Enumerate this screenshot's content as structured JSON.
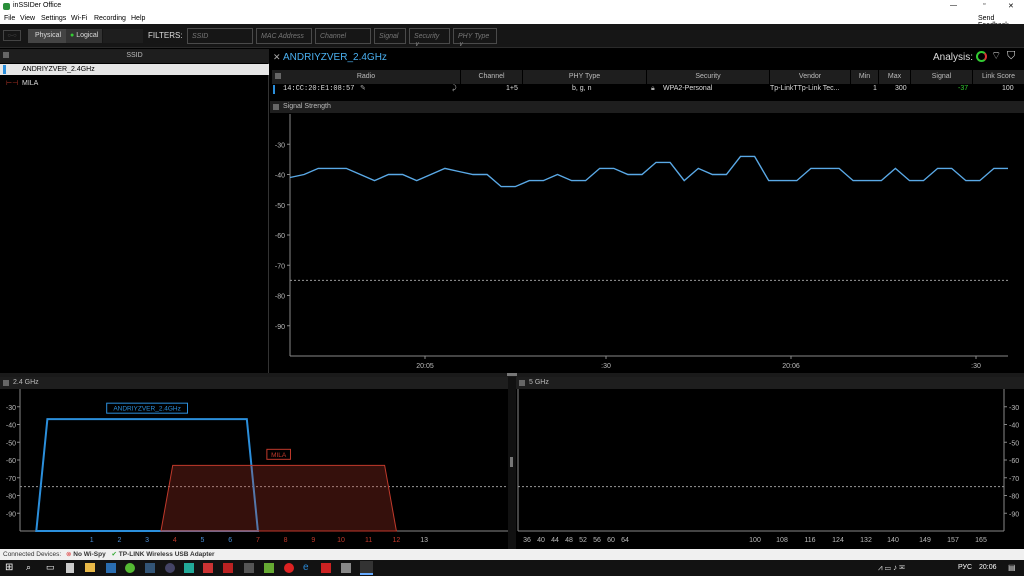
{
  "titlebar": {
    "title": "inSSIDer Office",
    "min": "—",
    "max": "▫",
    "close": "✕"
  },
  "menu": {
    "items": [
      "File",
      "View",
      "Settings",
      "Wi-Fi",
      "Recording",
      "Help"
    ],
    "feedback": "Send Feedback"
  },
  "toolbar": {
    "physical": "Physical",
    "logical": "Logical",
    "filters_label": "FILTERS:",
    "filters": [
      "SSID",
      "MAC Address",
      "Channel",
      "Signal",
      "Security ∨",
      "PHY Type ∨"
    ]
  },
  "ssid_panel": {
    "header": "SSID",
    "networks": [
      {
        "name": "ANDRIYZVER_2.4GHz",
        "color": "#2b8fdc"
      },
      {
        "name": "MILA",
        "color": "#c0392b"
      }
    ]
  },
  "detail": {
    "network": "ANDRIYZVER_2.4GHz",
    "analysis_label": "Analysis:",
    "columns": [
      "Radio",
      "Channel",
      "PHY Type",
      "Security",
      "Vendor",
      "Min",
      "Max",
      "Signal",
      "Link Score"
    ],
    "row": {
      "radio": "14:CC:20:E1:08:57",
      "channel": "1+5",
      "phy": "b, g, n",
      "security": "WPA2-Personal",
      "vendor": "Tp-LinkTTp-Link Tec...",
      "min": "1",
      "max": "300",
      "signal": "-37",
      "link_score": "100"
    }
  },
  "signal_panel": {
    "title": "Signal Strength"
  },
  "band24": {
    "title": "2.4 GHz"
  },
  "band5": {
    "title": "5 GHz"
  },
  "status": {
    "label": "Connected Devices:",
    "item1": "No Wi-Spy",
    "item2": "TP-LINK Wireless USB Adapter"
  },
  "taskbar": {
    "lang": "РУС",
    "time": "20:06"
  },
  "chart_data": [
    {
      "type": "line",
      "title": "Signal Strength",
      "ylim": [
        -100,
        -20
      ],
      "y_ticks": [
        "-30",
        "-40",
        "-50",
        "-60",
        "-70",
        "-80",
        "-90"
      ],
      "x_ticks": [
        "20:05",
        ":30",
        "20:06",
        ":30"
      ],
      "threshold": -75,
      "series": [
        {
          "name": "ANDRIYZVER_2.4GHz",
          "color": "#5aa9e6",
          "values": [
            -41,
            -40,
            -38,
            -38,
            -38,
            -40,
            -42,
            -40,
            -40,
            -42,
            -40,
            -38,
            -39,
            -40,
            -40,
            -44,
            -44,
            -42,
            -42,
            -40,
            -42,
            -42,
            -38,
            -38,
            -40,
            -40,
            -36,
            -36,
            -42,
            -38,
            -40,
            -40,
            -34,
            -34,
            -42,
            -42,
            -42,
            -38,
            -38,
            -38,
            -42,
            -42,
            -42,
            -38,
            -42,
            -42,
            -38,
            -38,
            -42,
            -42,
            -38,
            -38
          ]
        }
      ]
    },
    {
      "type": "area",
      "title": "2.4 GHz",
      "ylim": [
        -100,
        -20
      ],
      "y_ticks": [
        "-30",
        "-40",
        "-50",
        "-60",
        "-70",
        "-80",
        "-90"
      ],
      "x_ticks": [
        "1",
        "2",
        "3",
        "4",
        "5",
        "6",
        "7",
        "8",
        "9",
        "10",
        "11",
        "12",
        "13"
      ],
      "threshold": -75,
      "series": [
        {
          "name": "ANDRIYZVER_2.4GHz",
          "color": "#2b8fdc",
          "from": -1,
          "to": 7,
          "level": -37
        },
        {
          "name": "MILA",
          "color": "#c0392b",
          "from": 3.5,
          "to": 12,
          "level": -63
        }
      ]
    },
    {
      "type": "area",
      "title": "5 GHz",
      "ylim": [
        -100,
        -20
      ],
      "y_ticks": [
        "-30",
        "-40",
        "-50",
        "-60",
        "-70",
        "-80",
        "-90"
      ],
      "x_ticks": [
        "36",
        "40",
        "44",
        "48",
        "52",
        "56",
        "60",
        "64",
        "100",
        "108",
        "116",
        "124",
        "132",
        "140",
        "149",
        "157",
        "165"
      ],
      "threshold": -75,
      "series": []
    }
  ]
}
